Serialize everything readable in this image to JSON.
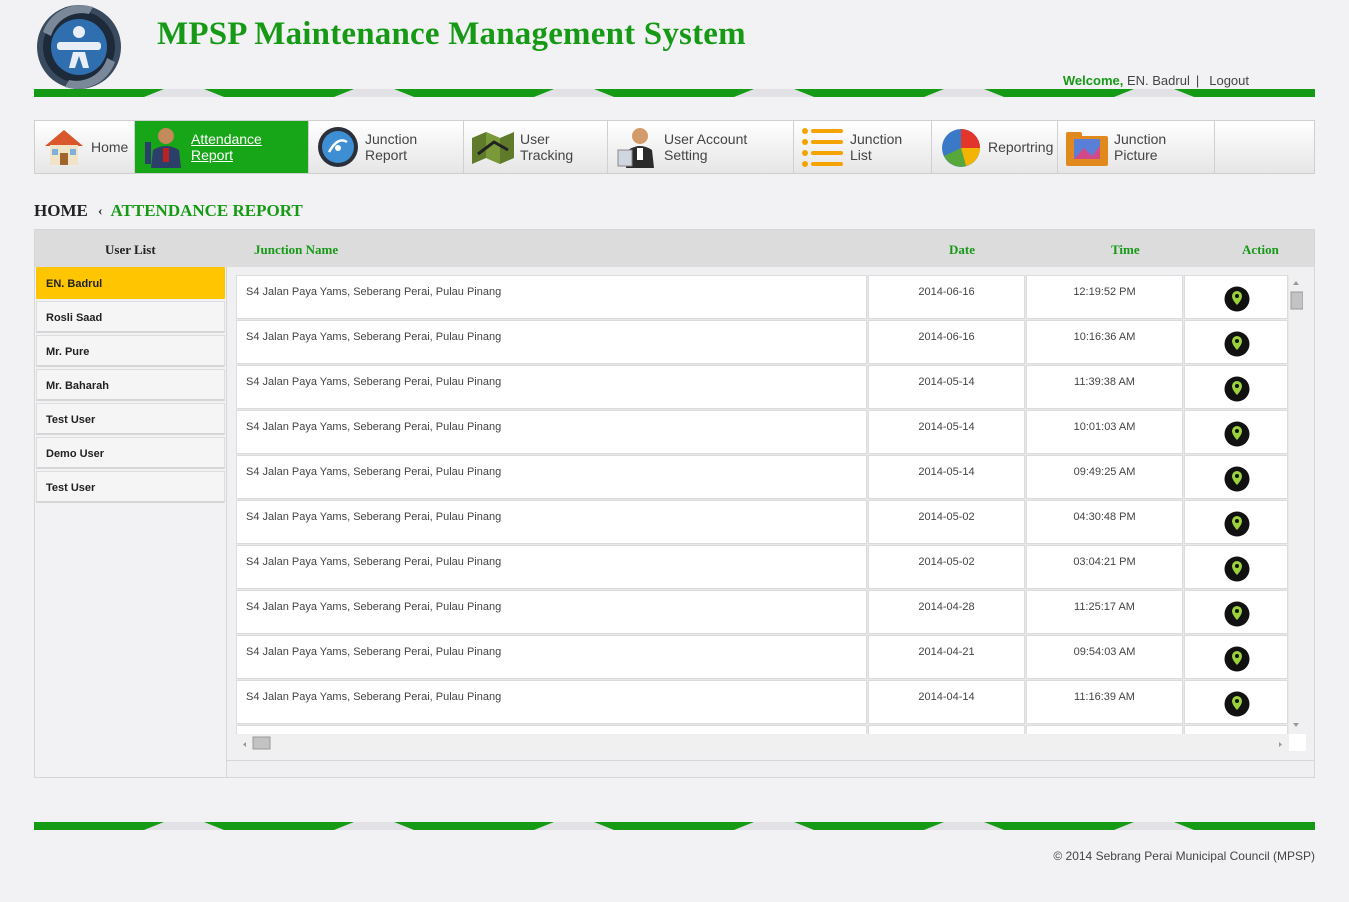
{
  "header": {
    "title": "MPSP Maintenance Management System",
    "welcome_label": "Welcome,",
    "user_name": "EN. Badrul",
    "separator": "|",
    "logout": "Logout"
  },
  "nav": {
    "items": [
      {
        "label": "Home",
        "icon": "house-icon"
      },
      {
        "label": "Attendance Report",
        "icon": "person-icon",
        "active": true
      },
      {
        "label": "Junction Report",
        "icon": "satellite-icon"
      },
      {
        "label": "User Tracking",
        "icon": "map-icon"
      },
      {
        "label": "User Account Setting",
        "icon": "user-account-icon"
      },
      {
        "label": "Junction List",
        "icon": "list-icon"
      },
      {
        "label": "Reportring",
        "icon": "pie-chart-icon"
      },
      {
        "label": "Junction Picture",
        "icon": "picture-folder-icon"
      }
    ]
  },
  "breadcrumb": {
    "home": "HOME",
    "current": "ATTENDANCE REPORT"
  },
  "table": {
    "headers": {
      "user_list": "User List",
      "junction": "Junction Name",
      "date": "Date",
      "time": "Time",
      "action": "Action"
    },
    "users": [
      "EN. Badrul",
      "Rosli Saad",
      "Mr. Pure",
      "Mr. Baharah",
      "Test User",
      "Demo User",
      "Test User"
    ],
    "active_user_index": 0,
    "rows": [
      {
        "junction": "S4 Jalan Paya Yams, Seberang Perai, Pulau Pinang",
        "date": "2014-06-16",
        "time": "12:19:52 PM"
      },
      {
        "junction": "S4 Jalan Paya Yams, Seberang Perai, Pulau Pinang",
        "date": "2014-06-16",
        "time": "10:16:36 AM"
      },
      {
        "junction": "S4 Jalan Paya Yams, Seberang Perai, Pulau Pinang",
        "date": "2014-05-14",
        "time": "11:39:38 AM"
      },
      {
        "junction": "S4 Jalan Paya Yams, Seberang Perai, Pulau Pinang",
        "date": "2014-05-14",
        "time": "10:01:03 AM"
      },
      {
        "junction": "S4 Jalan Paya Yams, Seberang Perai, Pulau Pinang",
        "date": "2014-05-14",
        "time": "09:49:25 AM"
      },
      {
        "junction": "S4 Jalan Paya Yams, Seberang Perai, Pulau Pinang",
        "date": "2014-05-02",
        "time": "04:30:48 PM"
      },
      {
        "junction": "S4 Jalan Paya Yams, Seberang Perai, Pulau Pinang",
        "date": "2014-05-02",
        "time": "03:04:21 PM"
      },
      {
        "junction": "S4 Jalan Paya Yams, Seberang Perai, Pulau Pinang",
        "date": "2014-04-28",
        "time": "11:25:17 AM"
      },
      {
        "junction": "S4 Jalan Paya Yams, Seberang Perai, Pulau Pinang",
        "date": "2014-04-21",
        "time": "09:54:03 AM"
      },
      {
        "junction": "S4 Jalan Paya Yams, Seberang Perai, Pulau Pinang",
        "date": "2014-04-14",
        "time": "11:16:39 AM"
      },
      {
        "junction": "",
        "date": "",
        "time": ""
      }
    ]
  },
  "footer": {
    "copyright": "© 2014 Sebrang Perai Municipal Council (MPSP)"
  },
  "colors": {
    "brand_green": "#169a16",
    "active_nav": "#17a617",
    "active_user": "#ffc600"
  }
}
